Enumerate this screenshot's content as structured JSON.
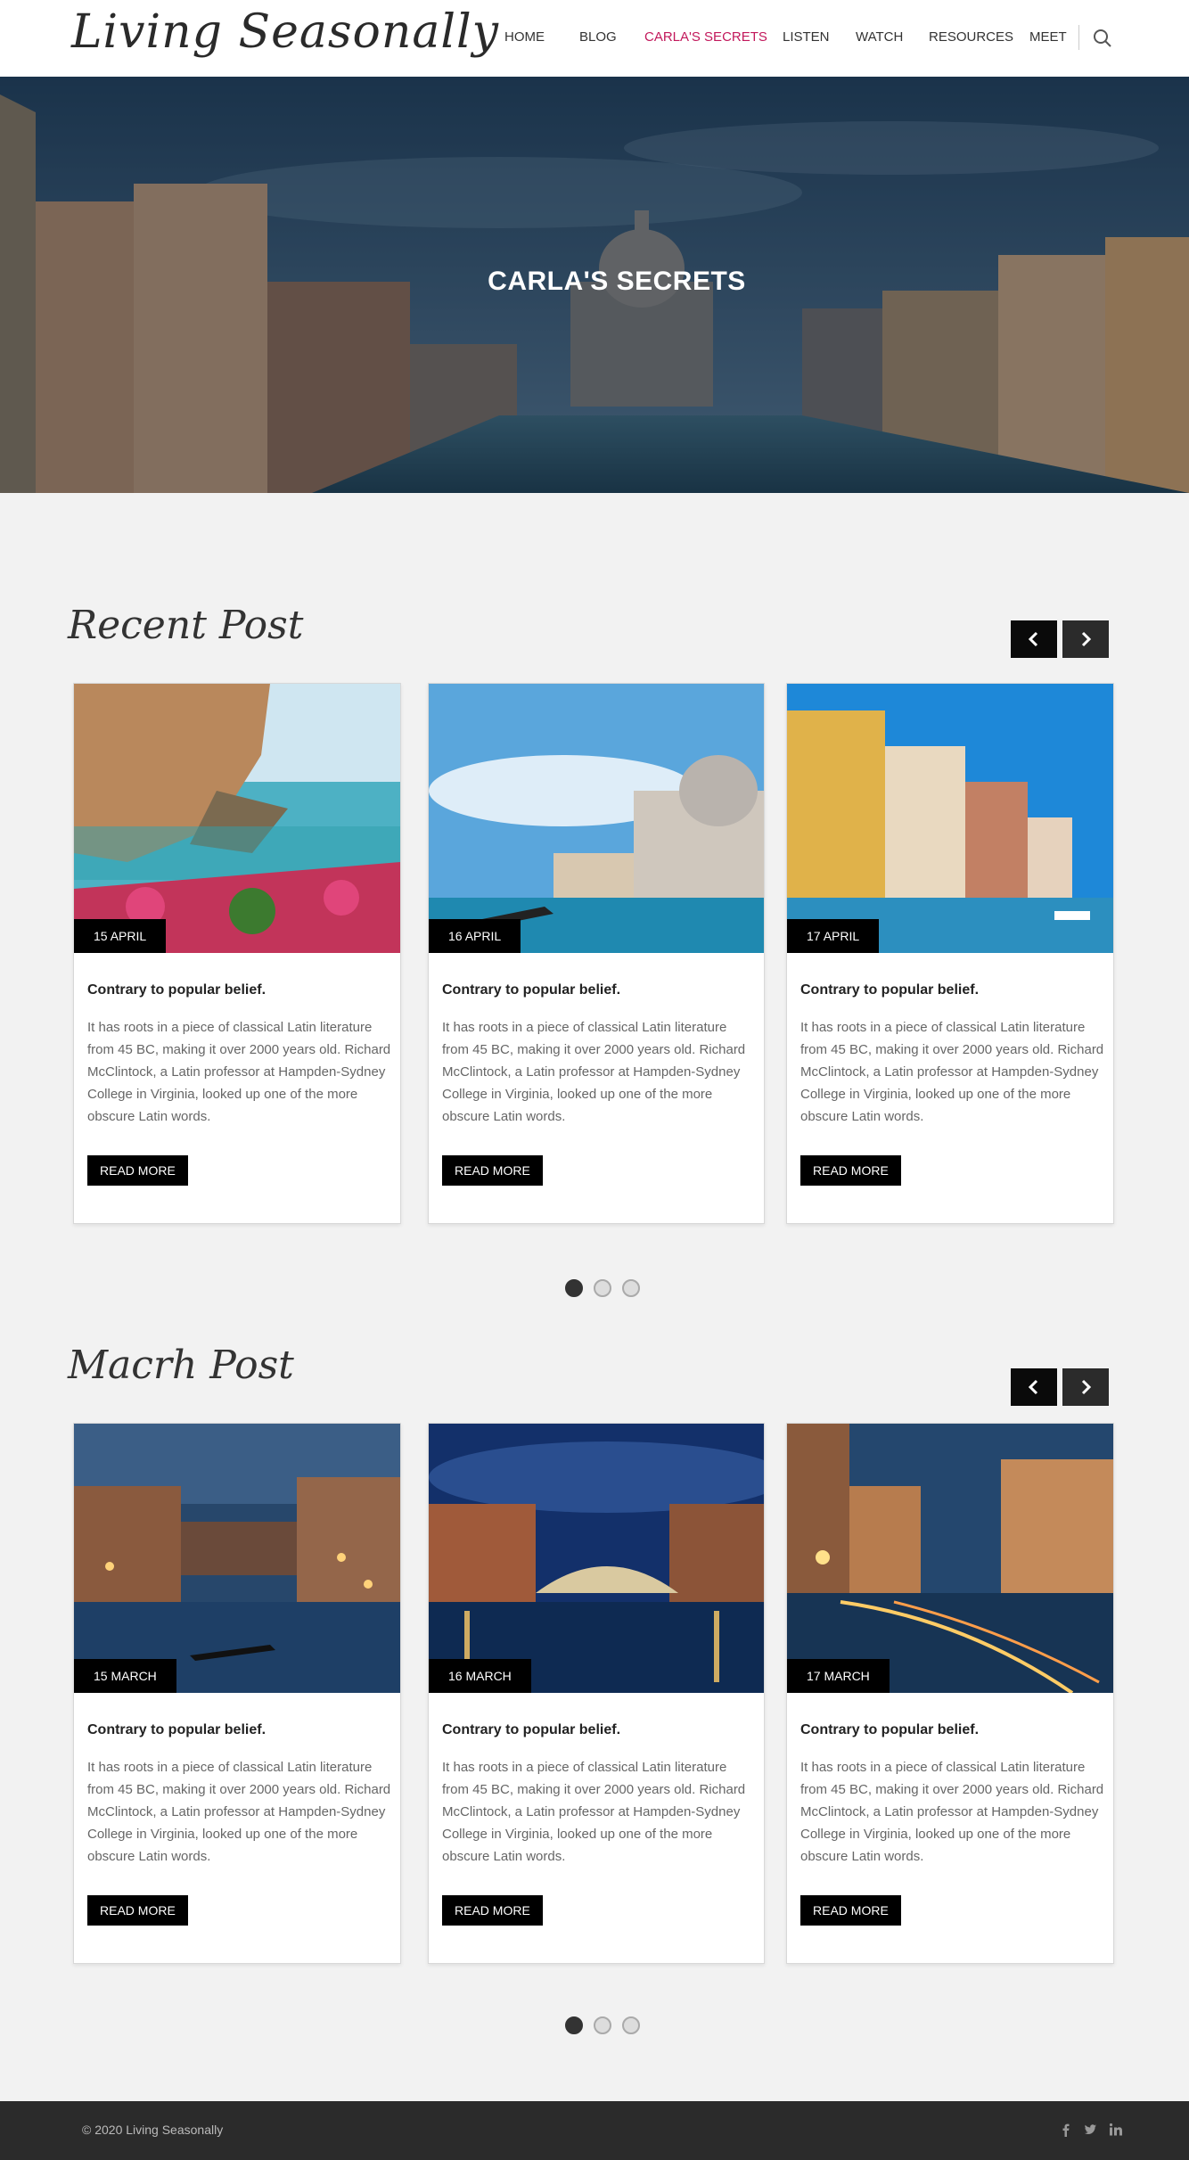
{
  "header": {
    "logo": "Living Seasonally",
    "nav": [
      {
        "label": "HOME"
      },
      {
        "label": "BLOG"
      },
      {
        "label": "CARLA'S SECRETS"
      },
      {
        "label": "LISTEN"
      },
      {
        "label": "WATCH"
      },
      {
        "label": "RESOURCES"
      },
      {
        "label": "MEET"
      }
    ],
    "active_color": "#c2185b"
  },
  "hero": {
    "title": "CARLA'S SECRETS"
  },
  "recent": {
    "title": "Recent Post",
    "posts": [
      {
        "date": "15 APRIL",
        "title": "Contrary to popular belief.",
        "text": "It has roots in a piece of classical Latin literature from 45 BC, making it over 2000 years old. Richard McClintock, a Latin professor at Hampden-Sydney College in Virginia, looked up one of the more obscure Latin words.",
        "button": "READ MORE"
      },
      {
        "date": "16 APRIL",
        "title": "Contrary to popular belief.",
        "text": "It has roots in a piece of classical Latin literature from 45 BC, making it over 2000 years old. Richard McClintock, a Latin professor at Hampden-Sydney College in Virginia, looked up one of the more obscure Latin words.",
        "button": "READ MORE"
      },
      {
        "date": "17 APRIL",
        "title": "Contrary to popular belief.",
        "text": "It has roots in a piece of classical Latin literature from 45 BC, making it over 2000 years old. Richard McClintock, a Latin professor at Hampden-Sydney College in Virginia, looked up one of the more obscure Latin words.",
        "button": "READ MORE"
      }
    ]
  },
  "march": {
    "title": "Macrh Post",
    "posts": [
      {
        "date": "15 MARCH",
        "title": "Contrary to popular belief.",
        "text": "It has roots in a piece of classical Latin literature from 45 BC, making it over 2000 years old. Richard McClintock, a Latin professor at Hampden-Sydney College in Virginia, looked up one of the more obscure Latin words.",
        "button": "READ MORE"
      },
      {
        "date": "16 MARCH",
        "title": "Contrary to popular belief.",
        "text": "It has roots in a piece of classical Latin literature from 45 BC, making it over 2000 years old. Richard McClintock, a Latin professor at Hampden-Sydney College in Virginia, looked up one of the more obscure Latin words.",
        "button": "READ MORE"
      },
      {
        "date": "17 MARCH",
        "title": "Contrary to popular belief.",
        "text": "It has roots in a piece of classical Latin literature from 45 BC, making it over 2000 years old. Richard McClintock, a Latin professor at Hampden-Sydney College in Virginia, looked up one of the more obscure Latin words.",
        "button": "READ MORE"
      }
    ]
  },
  "footer": {
    "copyright": "© 2020 Living Seasonally",
    "social_icons": [
      "facebook-icon",
      "twitter-icon",
      "linkedin-icon"
    ]
  }
}
